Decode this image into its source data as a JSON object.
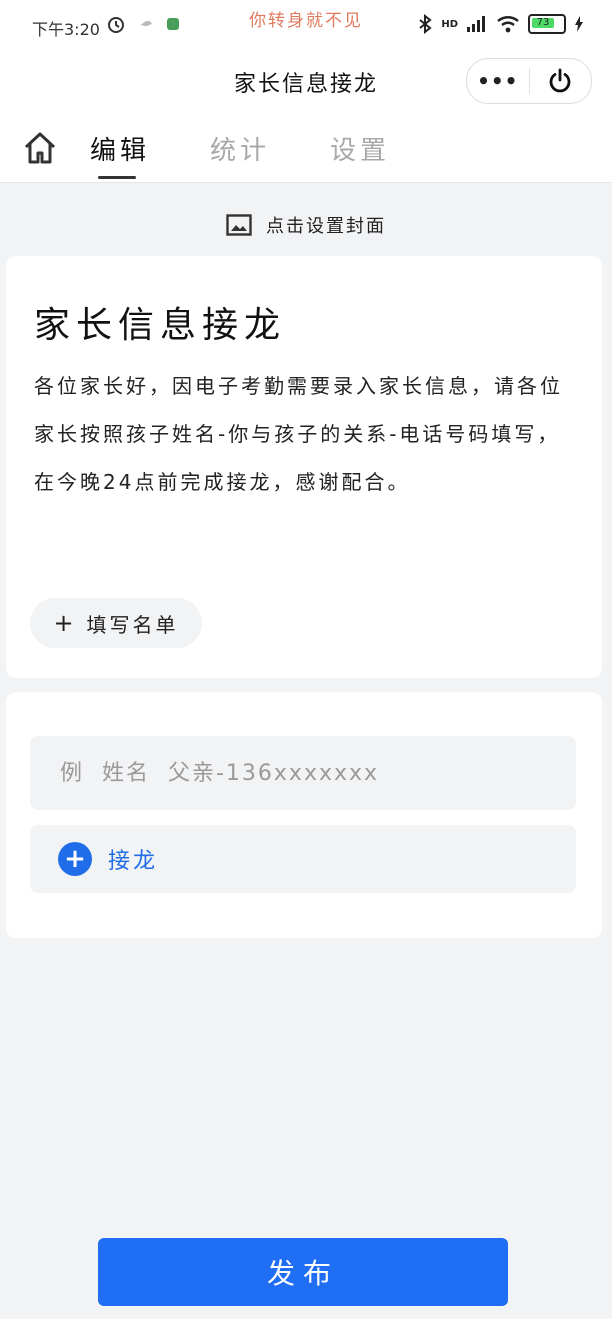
{
  "status_bar": {
    "time": "下午3:20",
    "tagline": "你转身就不见",
    "network": "HD",
    "battery": "73"
  },
  "header": {
    "title": "家长信息接龙",
    "more_label": "•••"
  },
  "tabs": [
    {
      "label": "编辑",
      "active": true
    },
    {
      "label": "统计",
      "active": false
    },
    {
      "label": "设置",
      "active": false
    }
  ],
  "cover": {
    "label": "点击设置封面"
  },
  "notice": {
    "title": "家长信息接龙",
    "description": "各位家长好，因电子考勤需要录入家长信息，请各位家长按照孩子姓名-你与孩子的关系-电话号码填写，在今晚24点前完成接龙，感谢配合。",
    "fill_list_label": "填写名单"
  },
  "entry": {
    "placeholder": "例  姓名  父亲-136xxxxxxx",
    "value": "",
    "join_label": "接龙"
  },
  "publish": {
    "label": "发布"
  },
  "colors": {
    "accent": "#1f6ef4",
    "tagline": "#e07a5f",
    "background": "#f2f3f5"
  }
}
